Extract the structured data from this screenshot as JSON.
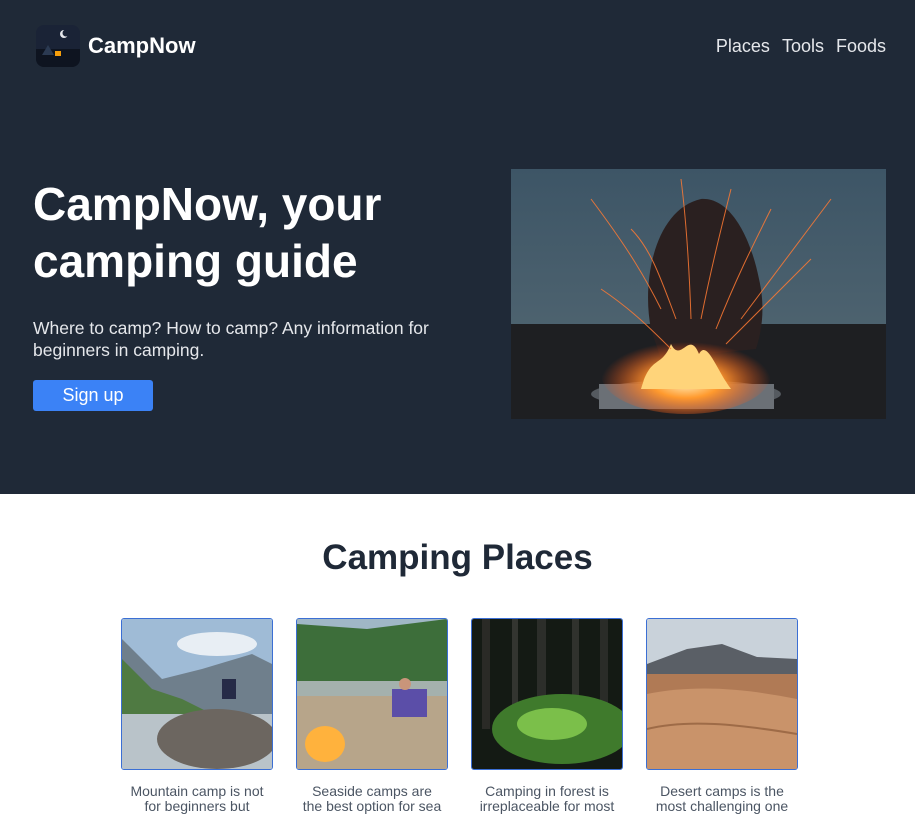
{
  "header": {
    "brand": "CampNow",
    "nav": [
      "Places",
      "Tools",
      "Foods"
    ]
  },
  "hero": {
    "title": "CampNow, your camping guide",
    "subtitle": "Where to camp? How to camp? Any information for beginners in camping.",
    "signup_label": "Sign up"
  },
  "places": {
    "title": "Camping Places",
    "cards": [
      {
        "caption": "Mountain camp is not for beginners but"
      },
      {
        "caption": "Seaside camps are the best option for sea"
      },
      {
        "caption": "Camping in forest is irreplaceable for most"
      },
      {
        "caption": "Desert camps is the most challenging one"
      }
    ]
  },
  "colors": {
    "hero_bg": "#1f2937",
    "accent": "#3b82f6",
    "card_border": "#3b6fd4"
  }
}
